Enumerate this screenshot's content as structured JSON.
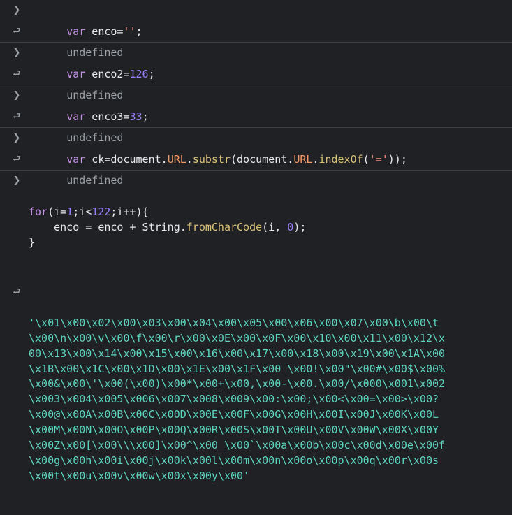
{
  "icons": {
    "input": "chevron-right-icon",
    "output": "return-arrow-icon"
  },
  "glyphs": {
    "input": "❯",
    "output": "⮐"
  },
  "entries": [
    {
      "in": {
        "kw": "var",
        "rest": " enco=",
        "str": "''",
        "tail": ";"
      },
      "out": "undefined"
    },
    {
      "in": {
        "kw": "var",
        "rest": " enco2=",
        "num": "126",
        "tail": ";"
      },
      "out": "undefined"
    },
    {
      "in": {
        "kw": "var",
        "rest": " enco3=",
        "num": "33",
        "tail": ";"
      },
      "out": "undefined"
    },
    {
      "in": {
        "kw": "var",
        "p1": " ck=document.",
        "prop1": "URL",
        "p2": ".",
        "fn1": "substr",
        "p3": "(document.",
        "prop2": "URL",
        "p4": ".",
        "fn2": "indexOf",
        "p5": "(",
        "str": "'='",
        "p6": "));"
      },
      "out": "undefined"
    }
  ],
  "loop": {
    "l1": {
      "kw": "for",
      "p1": "(i=",
      "n1": "1",
      "p2": ";i<",
      "n2": "122",
      "p3": ";i++){"
    },
    "l2": {
      "p1": "    enco = enco + String.",
      "fn": "fromCharCode",
      "p2": "(i, ",
      "n": "0",
      "p3": ");"
    },
    "l3": "}",
    "result": [
      "'\\x01\\x00\\x02\\x00\\x03\\x00\\x04\\x00\\x05\\x00\\x06\\x00\\x07\\x00\\b\\x00\\t",
      "\\x00\\n\\x00\\v\\x00\\f\\x00\\r\\x00\\x0E\\x00\\x0F\\x00\\x10\\x00\\x11\\x00\\x12\\x",
      "00\\x13\\x00\\x14\\x00\\x15\\x00\\x16\\x00\\x17\\x00\\x18\\x00\\x19\\x00\\x1A\\x00",
      "\\x1B\\x00\\x1C\\x00\\x1D\\x00\\x1E\\x00\\x1F\\x00 \\x00!\\x00\"\\x00#\\x00$\\x00%",
      "\\x00&\\x00\\'\\x00(\\x00)\\x00*\\x00+\\x00,\\x00-\\x00.\\x00/\\x000\\x001\\x002",
      "\\x003\\x004\\x005\\x006\\x007\\x008\\x009\\x00:\\x00;\\x00<\\x00=\\x00>\\x00?",
      "\\x00@\\x00A\\x00B\\x00C\\x00D\\x00E\\x00F\\x00G\\x00H\\x00I\\x00J\\x00K\\x00L",
      "\\x00M\\x00N\\x00O\\x00P\\x00Q\\x00R\\x00S\\x00T\\x00U\\x00V\\x00W\\x00X\\x00Y",
      "\\x00Z\\x00[\\x00\\\\\\x00]\\x00^\\x00_\\x00`\\x00a\\x00b\\x00c\\x00d\\x00e\\x00f",
      "\\x00g\\x00h\\x00i\\x00j\\x00k\\x00l\\x00m\\x00n\\x00o\\x00p\\x00q\\x00r\\x00s",
      "\\x00t\\x00u\\x00v\\x00w\\x00x\\x00y\\x00'"
    ]
  }
}
